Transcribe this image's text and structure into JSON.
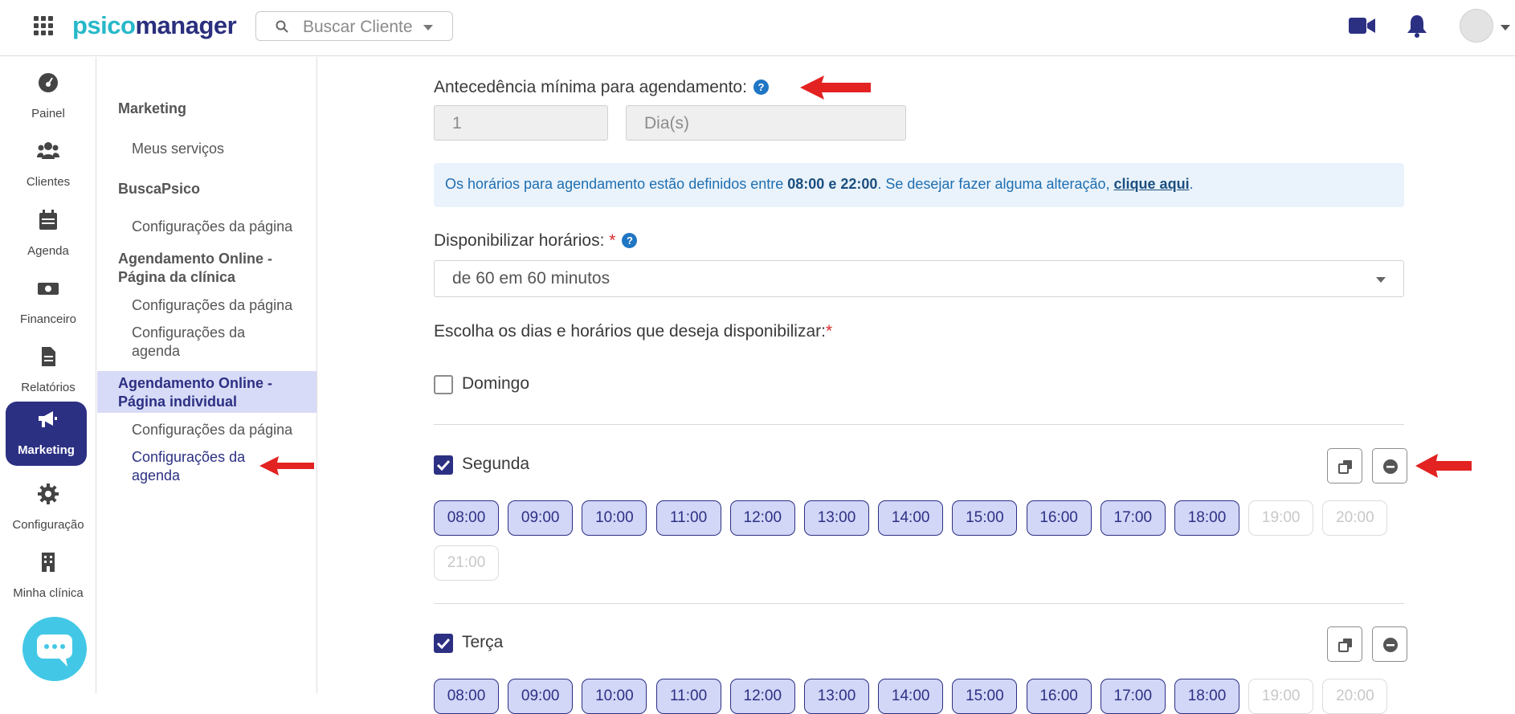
{
  "topbar": {
    "logo_part1": "psico",
    "logo_part2": "manager",
    "search_placeholder": "Buscar Cliente",
    "icons": [
      "grid-icon",
      "search-icon",
      "video-icon",
      "bell-icon",
      "avatar"
    ]
  },
  "rail": {
    "items": [
      {
        "label": "Painel",
        "icon": "gauge-icon"
      },
      {
        "label": "Clientes",
        "icon": "users-icon"
      },
      {
        "label": "Agenda",
        "icon": "calendar-icon"
      },
      {
        "label": "Financeiro",
        "icon": "money-icon"
      },
      {
        "label": "Relatórios",
        "icon": "report-icon"
      },
      {
        "label": "Marketing",
        "icon": "megaphone-icon",
        "active": true
      },
      {
        "label": "Configuração",
        "icon": "gear-icon"
      },
      {
        "label": "Minha clínica",
        "icon": "building-icon"
      }
    ]
  },
  "subnav": {
    "sec1": "Marketing",
    "sec1_item1": "Meus serviços",
    "sec2": "BuscaPsico",
    "sec2_item1": "Configurações da página",
    "sec3_line1": "Agendamento Online -",
    "sec3_line2": "Página da clínica",
    "sec3_item1": "Configurações da página",
    "sec3_item2_line1": "Configurações da",
    "sec3_item2_line2": "agenda",
    "sec4_line1": "Agendamento Online -",
    "sec4_line2": "Página individual",
    "sec4_item1": "Configurações da página",
    "sec4_item2_line1": "Configurações da",
    "sec4_item2_line2": "agenda"
  },
  "form": {
    "antecedencia_label": "Antecedência mínima para agendamento:",
    "antecedencia_value": "1",
    "antecedencia_unit": "Dia(s)",
    "info_pre": "Os horários para agendamento estão definidos entre ",
    "info_hours": "08:00 e 22:00",
    "info_mid": ". Se desejar fazer alguma alteração, ",
    "info_link": "clique aqui",
    "info_post": ".",
    "disponibilizar_label": "Disponibilizar horários:",
    "required_mark": "*",
    "interval_value": "de 60 em 60 minutos",
    "choose_days_label": "Escolha os dias e horários que deseja disponibilizar:",
    "help_glyph": "?"
  },
  "days": [
    {
      "name": "Domingo",
      "checked": false
    },
    {
      "name": "Segunda",
      "checked": true
    },
    {
      "name": "Terça",
      "checked": true
    }
  ],
  "slots": {
    "labels": [
      "08:00",
      "09:00",
      "10:00",
      "11:00",
      "12:00",
      "13:00",
      "14:00",
      "15:00",
      "16:00",
      "17:00",
      "18:00",
      "19:00",
      "20:00",
      "21:00"
    ],
    "segunda_selected": [
      true,
      true,
      true,
      true,
      true,
      true,
      true,
      true,
      true,
      true,
      true,
      false,
      false,
      false
    ],
    "terca_selected": [
      true,
      true,
      true,
      true,
      true,
      true,
      true,
      true,
      true,
      true,
      true,
      false,
      false
    ]
  },
  "colors": {
    "brand_dark": "#2c3083",
    "brand_light": "#26b8c9",
    "chip_selected_bg": "#d2d6f7",
    "info_bg": "#eaf3fb",
    "annotation_arrow": "#e32222"
  }
}
